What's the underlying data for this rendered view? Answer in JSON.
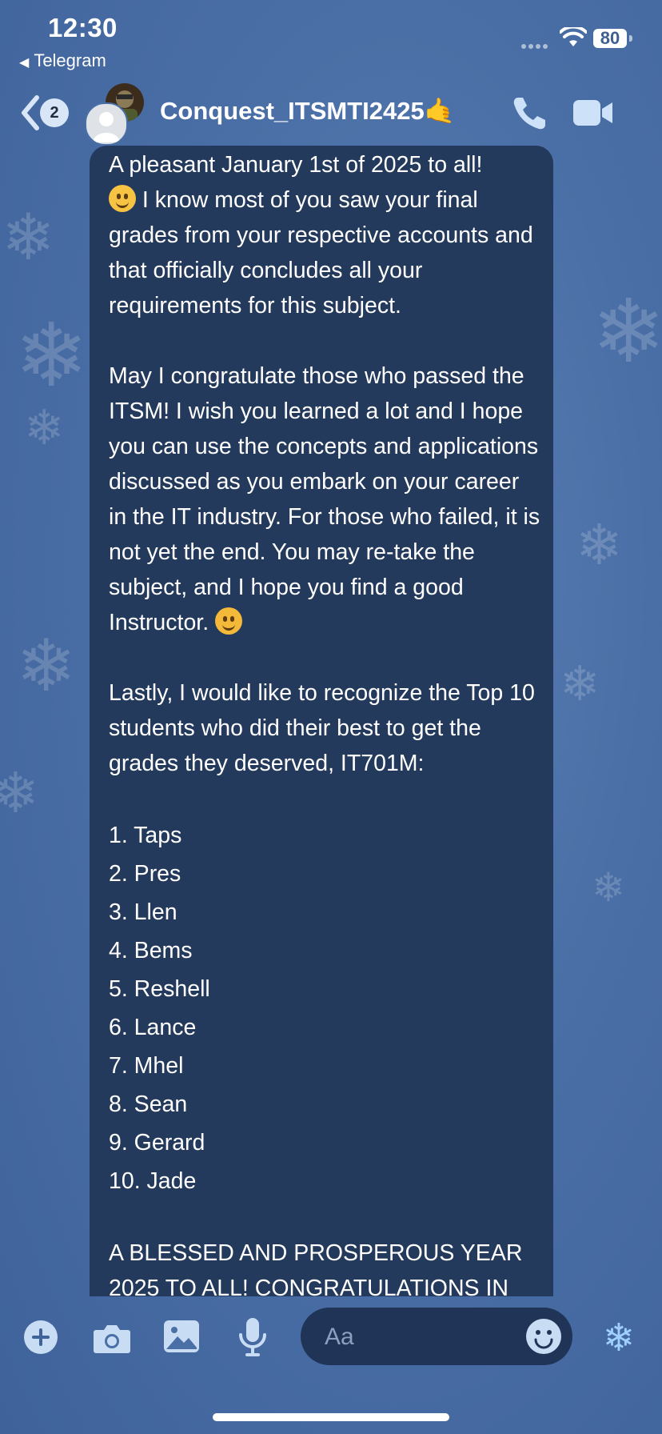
{
  "status_bar": {
    "time": "12:30",
    "back_app": "Telegram",
    "battery": "80"
  },
  "header": {
    "back_count": "2",
    "title": "Conquest_ITSMTI2425🤙",
    "icons": [
      "back-chevron-icon",
      "phone-icon",
      "video-camera-icon"
    ]
  },
  "message": {
    "intro_line1": "A pleasant January 1st of 2025 to all!",
    "intro_line2": "I know most of you saw your final grades from your respective accounts and that officially concludes all your requirements for this subject.",
    "para2_part1": "May I congratulate those who passed the ITSM! I wish you learned a lot and I hope you can use the concepts and applications discussed as you embark on your career in the IT industry. For those who failed, it is not yet the end. You may re-take the subject, and I hope you find a good Instructor.",
    "para3": "Lastly, I would like to recognize the Top 10 students who did their best to get the grades they deserved, IT701M:",
    "top_students": [
      "1.  Taps",
      "2.  Pres",
      "3.  Llen",
      "4.  Bems",
      "5.  Reshell",
      "6.  Lance",
      "7.  Mhel",
      "8.  Sean",
      "9.  Gerard",
      "10.  Jade"
    ],
    "closing": "A BLESSED AND PROSPEROUS YEAR 2025 TO ALL! CONGRATULATIONS IN"
  },
  "composer": {
    "placeholder": "Aa",
    "icons": [
      "plus-icon",
      "camera-icon",
      "gallery-icon",
      "microphone-icon",
      "emoji-icon",
      "snowflake-sticker-icon"
    ]
  }
}
